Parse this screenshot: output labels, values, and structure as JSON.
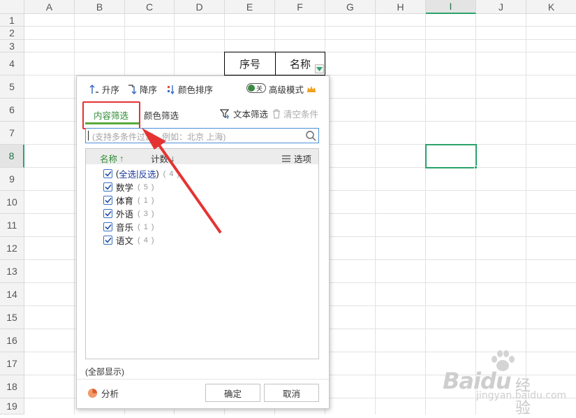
{
  "sheet": {
    "columns": [
      "A",
      "B",
      "C",
      "D",
      "E",
      "F",
      "G",
      "H",
      "I",
      "J",
      "K"
    ],
    "rows": [
      "1",
      "2",
      "3",
      "4",
      "5",
      "6",
      "7",
      "8",
      "9",
      "10",
      "11",
      "12",
      "13",
      "14",
      "15",
      "16",
      "17",
      "18",
      "19"
    ],
    "active_column": "I",
    "active_row": "8",
    "cells": {
      "E4": "序号",
      "F4": "名称"
    },
    "accent_color": "#2aa36b"
  },
  "filter_panel": {
    "toolbar": {
      "sort_asc": "升序",
      "sort_desc": "降序",
      "color_sort": "颜色排序",
      "toggle_label": "关",
      "advanced_mode": "高级模式"
    },
    "tabs": {
      "content_filter": "内容筛选",
      "color_filter": "颜色筛选"
    },
    "text_filter": "文本筛选",
    "clear_conditions": "清空条件",
    "search_placeholder": "(支持多条件过滤，例如：北京  上海)",
    "list_header": {
      "name": "名称",
      "count": "计数",
      "options": "选项"
    },
    "select_all": {
      "all": "全选",
      "inverse": "反选",
      "count": "4"
    },
    "items": [
      {
        "label": "数学",
        "count": "5",
        "checked": true
      },
      {
        "label": "体育",
        "count": "1",
        "checked": true
      },
      {
        "label": "外语",
        "count": "3",
        "checked": true
      },
      {
        "label": "音乐",
        "count": "1",
        "checked": true
      },
      {
        "label": "语文",
        "count": "4",
        "checked": true
      }
    ],
    "show_all": "(全部显示)",
    "analyze": "分析",
    "ok": "确定",
    "cancel": "取消",
    "highlight_color": "#e53333",
    "tab_active_color": "#2e8b35"
  },
  "watermark": {
    "brand": "Bai",
    "brand2": "du",
    "jingyan": "经验",
    "url": "jingyan.baidu.com"
  }
}
